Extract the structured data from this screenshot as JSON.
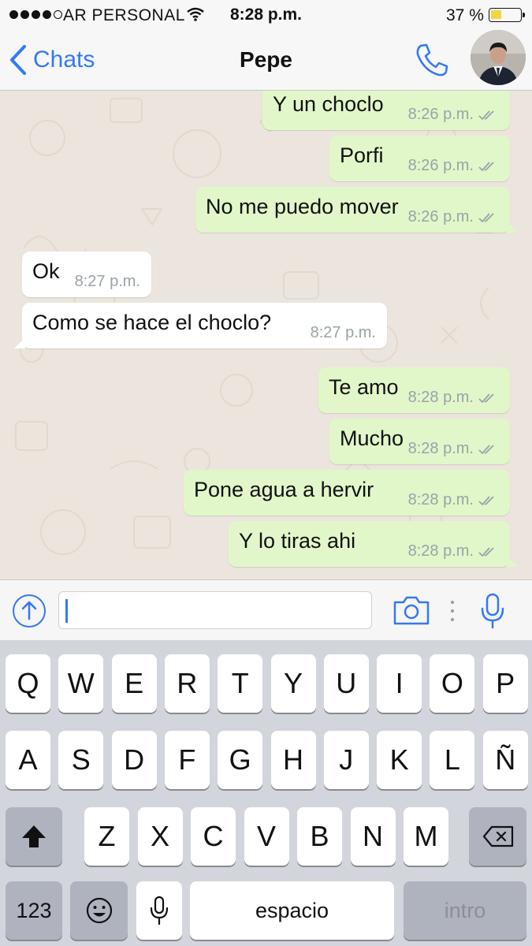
{
  "status_bar": {
    "carrier": "AR PERSONAL",
    "time": "8:28 p.m.",
    "battery_percent": "37 %",
    "battery_level": 0.37,
    "signal_bars_filled": 4,
    "signal_bars_total": 5
  },
  "nav": {
    "back_label": "Chats",
    "title": "Pepe"
  },
  "messages": [
    {
      "direction": "out",
      "text": "Y un choclo",
      "time": "8:26 p.m."
    },
    {
      "direction": "out",
      "text": "Porfi",
      "time": "8:26 p.m."
    },
    {
      "direction": "out",
      "text": "No me puedo mover",
      "time": "8:26 p.m."
    },
    {
      "direction": "in",
      "text": "Ok",
      "time": "8:27 p.m."
    },
    {
      "direction": "in",
      "text": "Como se hace el choclo?",
      "time": "8:27 p.m."
    },
    {
      "direction": "out",
      "text": "Te amo",
      "time": "8:28 p.m."
    },
    {
      "direction": "out",
      "text": "Mucho",
      "time": "8:28 p.m."
    },
    {
      "direction": "out",
      "text": "Pone agua a hervir",
      "time": "8:28 p.m."
    },
    {
      "direction": "out",
      "text": "Y lo tiras ahi",
      "time": "8:28 p.m."
    }
  ],
  "input": {
    "value": "",
    "icons": [
      "upload-icon",
      "camera-icon",
      "microphone-icon"
    ]
  },
  "keyboard": {
    "row1": [
      "Q",
      "W",
      "E",
      "R",
      "T",
      "Y",
      "U",
      "I",
      "O",
      "P"
    ],
    "row2": [
      "A",
      "S",
      "D",
      "F",
      "G",
      "H",
      "J",
      "K",
      "L",
      "Ñ"
    ],
    "row3": [
      "Z",
      "X",
      "C",
      "V",
      "B",
      "N",
      "M"
    ],
    "numbers_label": "123",
    "space_label": "espacio",
    "return_label": "intro",
    "icons": [
      "shift-icon",
      "backspace-icon",
      "emoji-icon",
      "dictation-icon"
    ]
  },
  "colors": {
    "accent": "#3478f6",
    "outgoing_bubble": "#e1f7c9",
    "incoming_bubble": "#ffffff",
    "chat_background": "#ece5dd",
    "keyboard_background": "#d2d5db",
    "battery_fill": "#f5d442"
  }
}
